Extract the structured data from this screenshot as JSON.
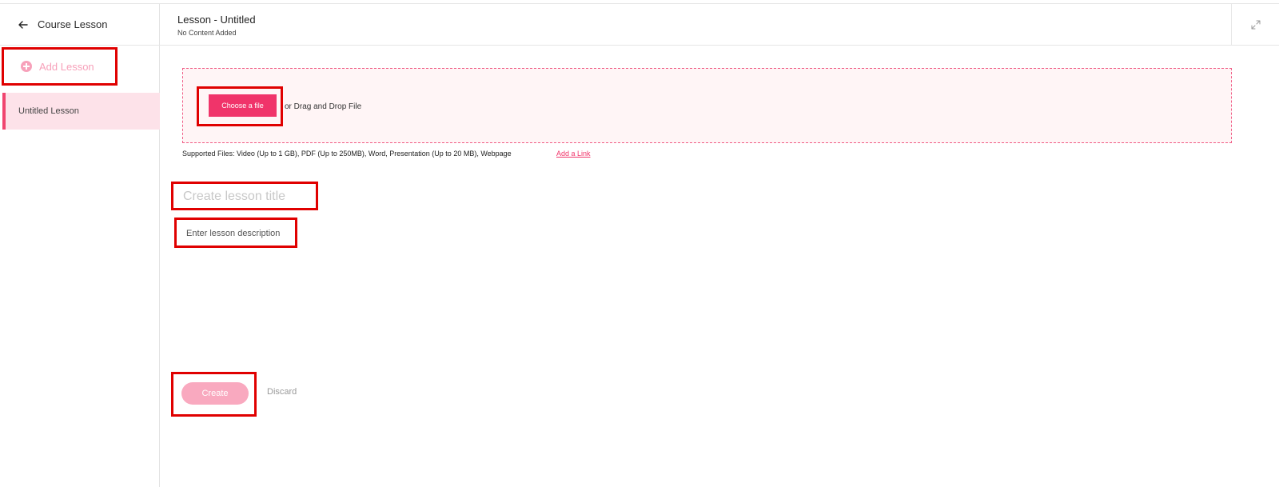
{
  "sidebar": {
    "back_icon": "arrow-left-icon",
    "title": "Course Lesson",
    "add_lesson_label": "Add Lesson",
    "add_icon": "plus-circle-icon",
    "lessons": [
      {
        "label": "Untitled Lesson",
        "active": true
      }
    ]
  },
  "header": {
    "title": "Lesson  - Untitled",
    "subtitle": "No Content Added",
    "expand_icon": "expand-icon"
  },
  "upload": {
    "choose_label": "Choose a file",
    "drag_text": "or Drag and Drop File",
    "supported_text": "Supported Files: Video (Up to 1 GB), PDF (Up to 250MB), Word, Presentation  (Up to 20 MB), Webpage",
    "add_link_label": "Add a Link"
  },
  "form": {
    "title_placeholder": "Create lesson title",
    "title_value": "",
    "description_placeholder": "Enter lesson description",
    "description_value": ""
  },
  "actions": {
    "create_label": "Create",
    "discard_label": "Discard"
  },
  "colors": {
    "accent": "#f0346a",
    "accent_light": "#f9a9bf",
    "active_bg": "#fde2e9",
    "dropzone_bg": "#fff5f6",
    "highlight_box": "#e00000"
  }
}
